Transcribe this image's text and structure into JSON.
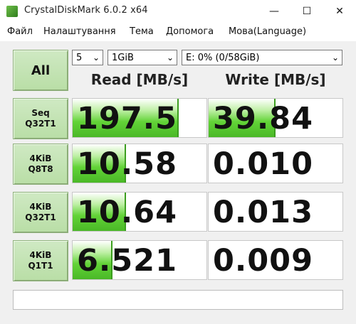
{
  "window": {
    "title": "CrystalDiskMark 6.0.2 x64",
    "controls": {
      "minimize": "—",
      "maximize": "☐",
      "close": "✕"
    }
  },
  "menu": [
    "Файл",
    "Налаштування",
    "Тема",
    "Допомога",
    "Мова(Language)"
  ],
  "toolbar": {
    "all_label": "All",
    "count": "5",
    "size": "1GiB",
    "drive": "E: 0% (0/58GiB)"
  },
  "headers": {
    "read": "Read [MB/s]",
    "write": "Write [MB/s]"
  },
  "tests": [
    {
      "line1": "Seq",
      "line2": "Q32T1",
      "read": "197.5",
      "write": "39.84",
      "read_fill": 0.79,
      "write_fill": 0.5
    },
    {
      "line1": "4KiB",
      "line2": "Q8T8",
      "read": "10.58",
      "write": "0.010",
      "read_fill": 0.4,
      "write_fill": 0.0
    },
    {
      "line1": "4KiB",
      "line2": "Q32T1",
      "read": "10.64",
      "write": "0.013",
      "read_fill": 0.4,
      "write_fill": 0.0
    },
    {
      "line1": "4KiB",
      "line2": "Q1T1",
      "read": "6.521",
      "write": "0.009",
      "read_fill": 0.3,
      "write_fill": 0.0
    }
  ],
  "colors": {
    "button": "#c5e4b4",
    "bar": "#4ab827"
  },
  "status_text": ""
}
